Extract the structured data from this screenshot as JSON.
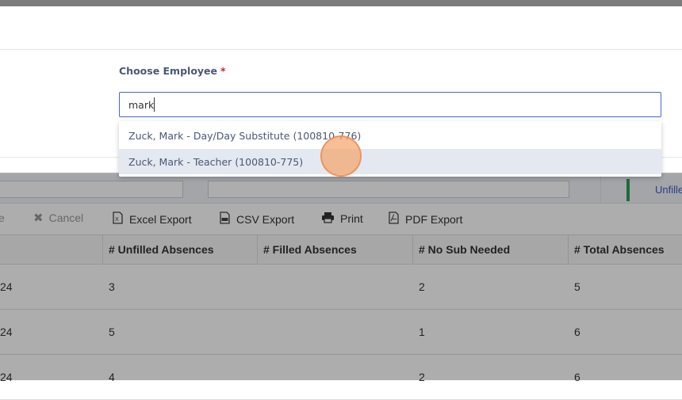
{
  "strip": {
    "unfilled_label": "Unfille"
  },
  "toolbar": {
    "partial_label": "e",
    "cancel_label": "Cancel",
    "excel_label": "Excel Export",
    "csv_label": "CSV Export",
    "print_label": "Print",
    "pdf_label": "PDF Export"
  },
  "grid": {
    "columns": [
      "",
      "# Unfilled Absences",
      "# Filled Absences",
      "# No Sub Needed",
      "# Total Absences"
    ],
    "rows": [
      {
        "c0": "24",
        "unfilled": "3",
        "filled": "",
        "no_sub": "2",
        "total": "5"
      },
      {
        "c0": "24",
        "unfilled": "5",
        "filled": "",
        "no_sub": "1",
        "total": "6"
      },
      {
        "c0": "24",
        "unfilled": "4",
        "filled": "",
        "no_sub": "2",
        "total": "6"
      }
    ]
  },
  "modal": {
    "field_label": "Choose Employee",
    "required_mark": "*",
    "search_value": "mark",
    "options": [
      {
        "label": "Zuck, Mark - Day/Day Substitute (100810-776)"
      },
      {
        "label": "Zuck, Mark - Teacher (100810-775)"
      }
    ]
  },
  "icons": {
    "cancel": "close-icon",
    "excel": "excel-file-icon",
    "csv": "csv-file-icon",
    "print": "printer-icon",
    "pdf": "pdf-file-icon"
  },
  "colors": {
    "accent_blue": "#4a64c8",
    "label_text": "#4a5876",
    "required_red": "#c62828",
    "highlight_row": "#e4e8f0",
    "status_green": "#2e9e5b"
  }
}
